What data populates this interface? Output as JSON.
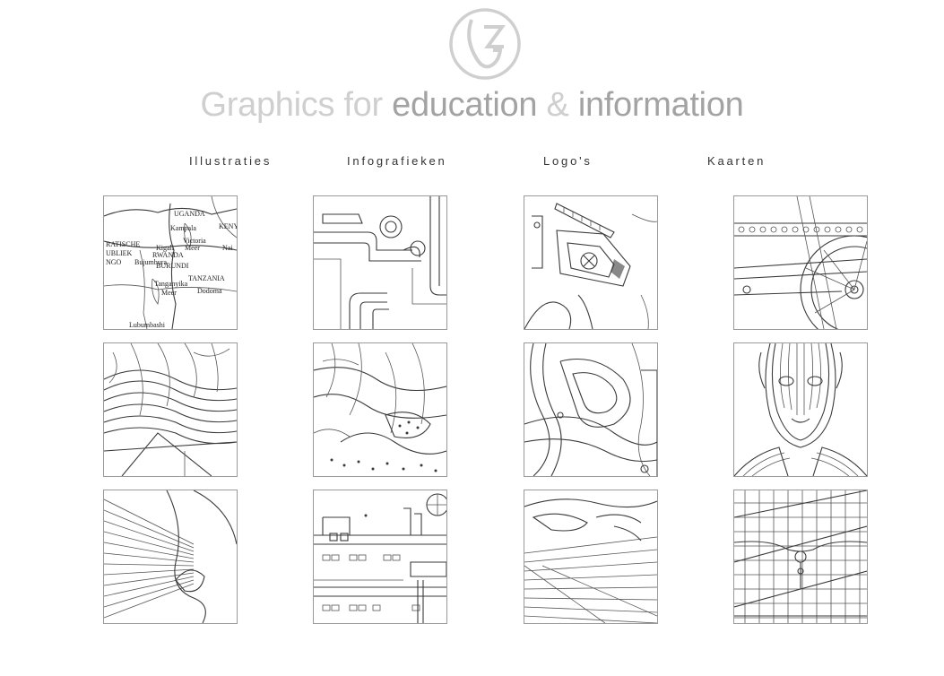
{
  "header": {
    "tagline_parts": [
      "Graphics for",
      "education",
      "&",
      "information"
    ]
  },
  "nav": {
    "items": [
      {
        "label": "Illustraties"
      },
      {
        "label": "Infografieken"
      },
      {
        "label": "Logo's"
      },
      {
        "label": "Kaarten"
      }
    ]
  },
  "map_thumbnail": {
    "labels": [
      "UGANDA",
      "KENY",
      "RATISCHE",
      "UBLIEK",
      "NGO",
      "RWANDA",
      "BURUNDI",
      "TANZANIA",
      "Victoria",
      "Meer",
      "Kampala",
      "Kigali",
      "Bujumbura",
      "Dodoma",
      "Tanganyika",
      "Meer",
      "Nai",
      "Lubumbashi"
    ]
  },
  "colors": {
    "logo": "#cfcfcf",
    "tagline_light": "#cfcfcf",
    "tagline_dark": "#a3a3a3",
    "nav_text": "#333333",
    "thumb_border": "#9a9a9a"
  }
}
